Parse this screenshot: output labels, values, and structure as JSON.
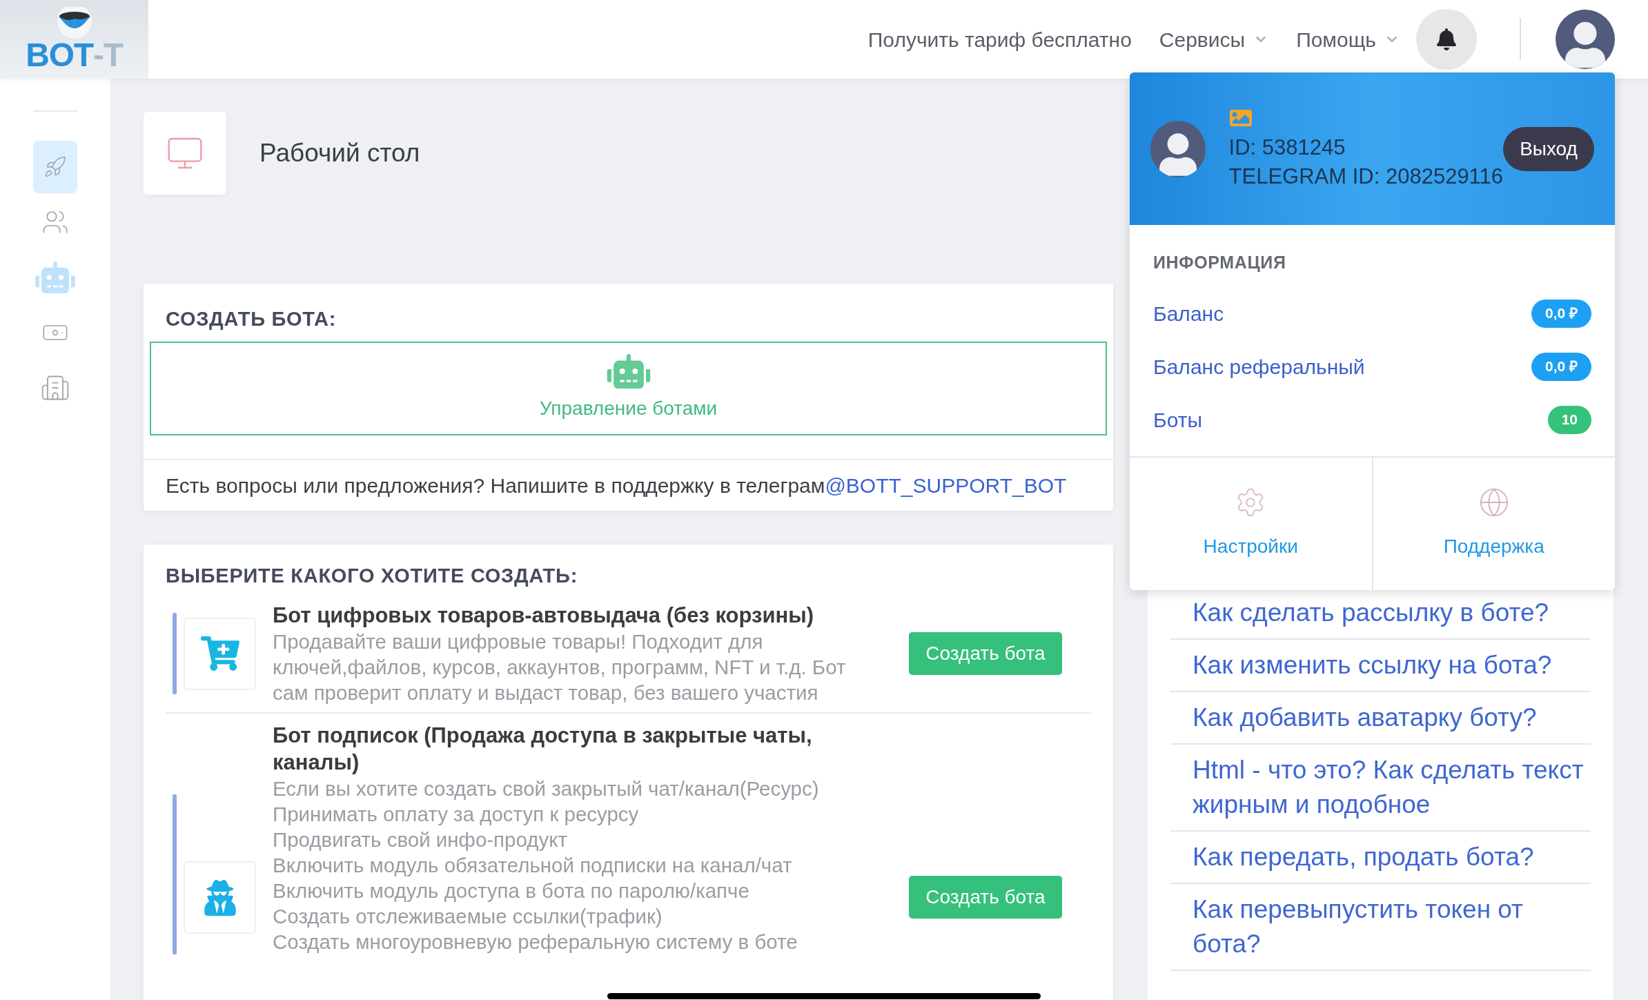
{
  "header": {
    "logo": {
      "text": "BOT",
      "suffix": "-T"
    },
    "nav": [
      {
        "label": "Получить тариф бесплатно",
        "dropdown": false
      },
      {
        "label": "Сервисы",
        "dropdown": true
      },
      {
        "label": "Помощь",
        "dropdown": true
      }
    ]
  },
  "sidebar": {
    "items": [
      {
        "kind": "rocket",
        "selected": true
      },
      {
        "kind": "users",
        "selected": false
      },
      {
        "kind": "robot",
        "selected": false
      },
      {
        "kind": "money",
        "selected": false
      },
      {
        "kind": "building",
        "selected": false
      }
    ]
  },
  "page_title": "Рабочий стол",
  "create_card": {
    "title": "СОЗДАТЬ БОТА:",
    "manage_label": "Управление ботами",
    "support_text": "Есть вопросы или предложения? Напишите в поддержку в телеграм",
    "support_link": "@BOTT_SUPPORT_BOT"
  },
  "choose_card": {
    "title": "ВЫБЕРИТЕ КАКОГО ХОТИТЕ СОЗДАТЬ:",
    "bots": [
      {
        "kind": "cart",
        "title": "Бот цифровых товаров-автовыдача (без корзины)",
        "lines": [
          "Продавайте ваши цифровые товары! Подходит для ключей,файлов, курсов, аккаунтов, программ, NFT и т.д. Бот сам проверит оплату и выдаст товар, без вашего участия"
        ],
        "button": "Создать бота"
      },
      {
        "kind": "spy",
        "title": "Бот подписок (Продажа доступа в закрытые чаты, каналы)",
        "lines": [
          "Если вы хотите создать свой закрытый чат/канал(Ресурс)",
          "Принимать оплату за доступ к ресурсу",
          "Продвигать свой инфо-продукт",
          "Включить модуль обязательной подписки на канал/чат",
          "Включить модуль доступа в бота по паролю/капче",
          "Создать отслеживаемые ссылки(трафик)",
          "Создать многоуровневую реферальную систему в боте"
        ],
        "button": "Создать бота"
      }
    ]
  },
  "help_links": [
    "Как сделать рассылку в боте?",
    "Как изменить ссылку на бота?",
    "Как добавить аватарку боту?",
    "Html - что это? Как сделать текст жирным и подобное",
    "Как передать, продать бота?",
    "Как перевыпустить токен от бота?"
  ],
  "profile_menu": {
    "id": "ID: 5381245",
    "telegram_id": "TELEGRAM ID: 2082529116",
    "logout": "Выход",
    "section_title": "ИНФОРМАЦИЯ",
    "stats": [
      {
        "label": "Баланс",
        "value": "0,0 ₽",
        "color": "#1ea0f2"
      },
      {
        "label": "Баланс реферальный",
        "value": "0,0 ₽",
        "color": "#1ea0f2"
      },
      {
        "label": "Боты",
        "value": "10",
        "color": "#34c27a"
      }
    ],
    "actions": [
      {
        "kind": "settings",
        "label": "Настройки"
      },
      {
        "kind": "support",
        "label": "Поддержка"
      }
    ]
  }
}
